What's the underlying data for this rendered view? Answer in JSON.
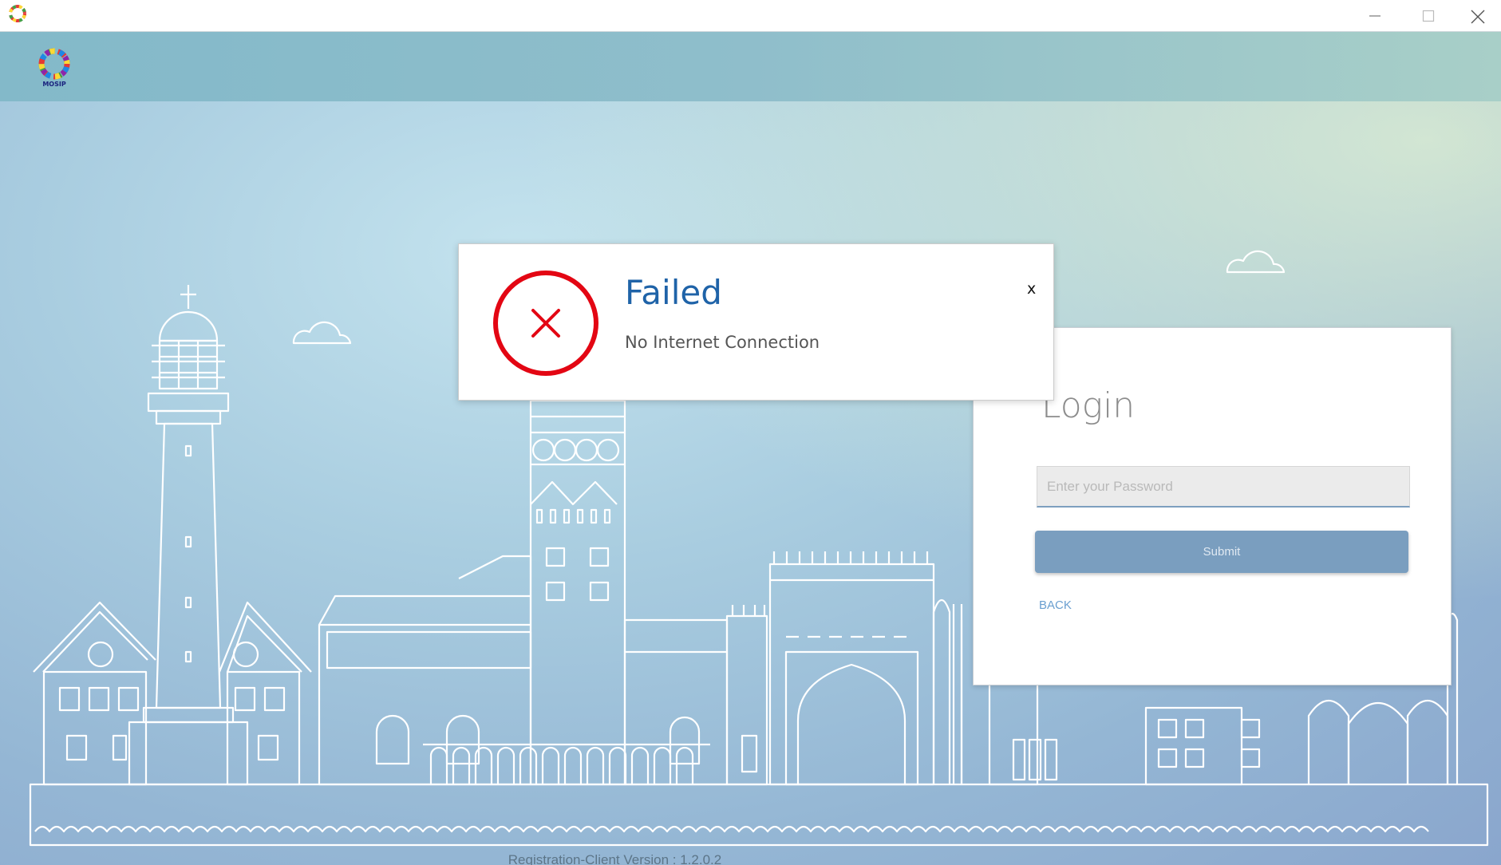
{
  "window": {
    "icons": [
      "app-logo-icon",
      "minimize-icon",
      "maximize-icon",
      "close-icon"
    ]
  },
  "header": {
    "logo_text": "MOSIP"
  },
  "login": {
    "title": "Login",
    "password_placeholder": "Enter your Password",
    "password_value": "",
    "submit_label": "Submit",
    "back_label": "BACK"
  },
  "dialog": {
    "title": "Failed",
    "message": "No Internet Connection",
    "close_label": "x",
    "icon": "error-x-icon",
    "status_color": "#e30613",
    "title_color": "#1f63a8"
  },
  "footer": {
    "version_text": "Registration-Client Version : 1.2.0.2"
  },
  "colors": {
    "header": "#8fbecb",
    "accent_button": "#7a9ebf",
    "link": "#6a9fd0"
  }
}
